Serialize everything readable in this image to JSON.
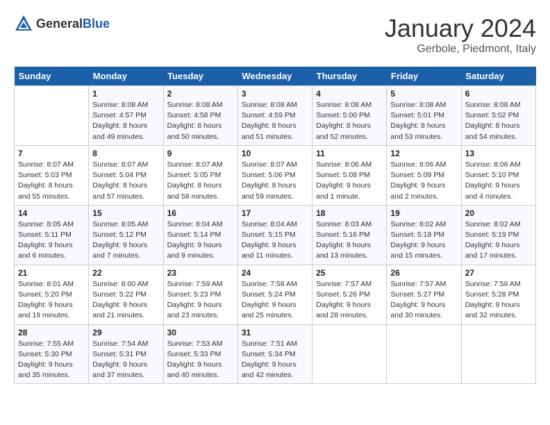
{
  "header": {
    "logo_general": "General",
    "logo_blue": "Blue",
    "month": "January 2024",
    "location": "Gerbole, Piedmont, Italy"
  },
  "weekdays": [
    "Sunday",
    "Monday",
    "Tuesday",
    "Wednesday",
    "Thursday",
    "Friday",
    "Saturday"
  ],
  "weeks": [
    [
      {
        "day": "",
        "sunrise": "",
        "sunset": "",
        "daylight": ""
      },
      {
        "day": "1",
        "sunrise": "Sunrise: 8:08 AM",
        "sunset": "Sunset: 4:57 PM",
        "daylight": "Daylight: 8 hours and 49 minutes."
      },
      {
        "day": "2",
        "sunrise": "Sunrise: 8:08 AM",
        "sunset": "Sunset: 4:58 PM",
        "daylight": "Daylight: 8 hours and 50 minutes."
      },
      {
        "day": "3",
        "sunrise": "Sunrise: 8:08 AM",
        "sunset": "Sunset: 4:59 PM",
        "daylight": "Daylight: 8 hours and 51 minutes."
      },
      {
        "day": "4",
        "sunrise": "Sunrise: 8:08 AM",
        "sunset": "Sunset: 5:00 PM",
        "daylight": "Daylight: 8 hours and 52 minutes."
      },
      {
        "day": "5",
        "sunrise": "Sunrise: 8:08 AM",
        "sunset": "Sunset: 5:01 PM",
        "daylight": "Daylight: 8 hours and 53 minutes."
      },
      {
        "day": "6",
        "sunrise": "Sunrise: 8:08 AM",
        "sunset": "Sunset: 5:02 PM",
        "daylight": "Daylight: 8 hours and 54 minutes."
      }
    ],
    [
      {
        "day": "7",
        "sunrise": "Sunrise: 8:07 AM",
        "sunset": "Sunset: 5:03 PM",
        "daylight": "Daylight: 8 hours and 55 minutes."
      },
      {
        "day": "8",
        "sunrise": "Sunrise: 8:07 AM",
        "sunset": "Sunset: 5:04 PM",
        "daylight": "Daylight: 8 hours and 57 minutes."
      },
      {
        "day": "9",
        "sunrise": "Sunrise: 8:07 AM",
        "sunset": "Sunset: 5:05 PM",
        "daylight": "Daylight: 8 hours and 58 minutes."
      },
      {
        "day": "10",
        "sunrise": "Sunrise: 8:07 AM",
        "sunset": "Sunset: 5:06 PM",
        "daylight": "Daylight: 8 hours and 59 minutes."
      },
      {
        "day": "11",
        "sunrise": "Sunrise: 8:06 AM",
        "sunset": "Sunset: 5:08 PM",
        "daylight": "Daylight: 9 hours and 1 minute."
      },
      {
        "day": "12",
        "sunrise": "Sunrise: 8:06 AM",
        "sunset": "Sunset: 5:09 PM",
        "daylight": "Daylight: 9 hours and 2 minutes."
      },
      {
        "day": "13",
        "sunrise": "Sunrise: 8:06 AM",
        "sunset": "Sunset: 5:10 PM",
        "daylight": "Daylight: 9 hours and 4 minutes."
      }
    ],
    [
      {
        "day": "14",
        "sunrise": "Sunrise: 8:05 AM",
        "sunset": "Sunset: 5:11 PM",
        "daylight": "Daylight: 9 hours and 6 minutes."
      },
      {
        "day": "15",
        "sunrise": "Sunrise: 8:05 AM",
        "sunset": "Sunset: 5:12 PM",
        "daylight": "Daylight: 9 hours and 7 minutes."
      },
      {
        "day": "16",
        "sunrise": "Sunrise: 8:04 AM",
        "sunset": "Sunset: 5:14 PM",
        "daylight": "Daylight: 9 hours and 9 minutes."
      },
      {
        "day": "17",
        "sunrise": "Sunrise: 8:04 AM",
        "sunset": "Sunset: 5:15 PM",
        "daylight": "Daylight: 9 hours and 11 minutes."
      },
      {
        "day": "18",
        "sunrise": "Sunrise: 8:03 AM",
        "sunset": "Sunset: 5:16 PM",
        "daylight": "Daylight: 9 hours and 13 minutes."
      },
      {
        "day": "19",
        "sunrise": "Sunrise: 8:02 AM",
        "sunset": "Sunset: 5:18 PM",
        "daylight": "Daylight: 9 hours and 15 minutes."
      },
      {
        "day": "20",
        "sunrise": "Sunrise: 8:02 AM",
        "sunset": "Sunset: 5:19 PM",
        "daylight": "Daylight: 9 hours and 17 minutes."
      }
    ],
    [
      {
        "day": "21",
        "sunrise": "Sunrise: 8:01 AM",
        "sunset": "Sunset: 5:20 PM",
        "daylight": "Daylight: 9 hours and 19 minutes."
      },
      {
        "day": "22",
        "sunrise": "Sunrise: 8:00 AM",
        "sunset": "Sunset: 5:22 PM",
        "daylight": "Daylight: 9 hours and 21 minutes."
      },
      {
        "day": "23",
        "sunrise": "Sunrise: 7:59 AM",
        "sunset": "Sunset: 5:23 PM",
        "daylight": "Daylight: 9 hours and 23 minutes."
      },
      {
        "day": "24",
        "sunrise": "Sunrise: 7:58 AM",
        "sunset": "Sunset: 5:24 PM",
        "daylight": "Daylight: 9 hours and 25 minutes."
      },
      {
        "day": "25",
        "sunrise": "Sunrise: 7:57 AM",
        "sunset": "Sunset: 5:26 PM",
        "daylight": "Daylight: 9 hours and 28 minutes."
      },
      {
        "day": "26",
        "sunrise": "Sunrise: 7:57 AM",
        "sunset": "Sunset: 5:27 PM",
        "daylight": "Daylight: 9 hours and 30 minutes."
      },
      {
        "day": "27",
        "sunrise": "Sunrise: 7:56 AM",
        "sunset": "Sunset: 5:28 PM",
        "daylight": "Daylight: 9 hours and 32 minutes."
      }
    ],
    [
      {
        "day": "28",
        "sunrise": "Sunrise: 7:55 AM",
        "sunset": "Sunset: 5:30 PM",
        "daylight": "Daylight: 9 hours and 35 minutes."
      },
      {
        "day": "29",
        "sunrise": "Sunrise: 7:54 AM",
        "sunset": "Sunset: 5:31 PM",
        "daylight": "Daylight: 9 hours and 37 minutes."
      },
      {
        "day": "30",
        "sunrise": "Sunrise: 7:53 AM",
        "sunset": "Sunset: 5:33 PM",
        "daylight": "Daylight: 9 hours and 40 minutes."
      },
      {
        "day": "31",
        "sunrise": "Sunrise: 7:51 AM",
        "sunset": "Sunset: 5:34 PM",
        "daylight": "Daylight: 9 hours and 42 minutes."
      },
      {
        "day": "",
        "sunrise": "",
        "sunset": "",
        "daylight": ""
      },
      {
        "day": "",
        "sunrise": "",
        "sunset": "",
        "daylight": ""
      },
      {
        "day": "",
        "sunrise": "",
        "sunset": "",
        "daylight": ""
      }
    ]
  ]
}
